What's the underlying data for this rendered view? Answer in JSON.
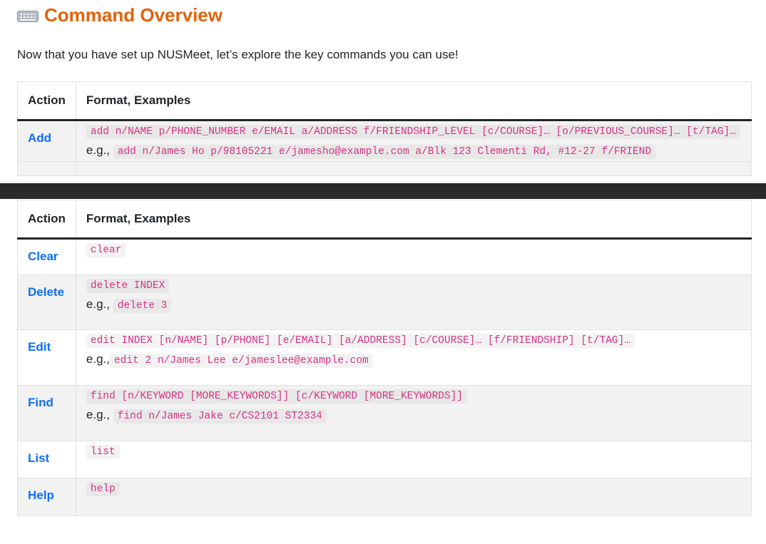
{
  "section": {
    "title": "Command Overview",
    "title_icon": "keyboard-icon",
    "intro": "Now that you have set up NUSMeet, let’s explore the key commands you can use!"
  },
  "table": {
    "headers": {
      "action": "Action",
      "format": "Format, Examples"
    },
    "eg_label": "e.g.,",
    "top_rows": [
      {
        "action": "Add",
        "format": "add n/NAME p/PHONE_NUMBER e/EMAIL a/ADDRESS f/FRIENDSHIP_LEVEL [c/COURSE]… [o/PREVIOUS_COURSE]… [t/TAG]…",
        "example": "add n/James Ho p/98105221 e/jamesho@example.com a/Blk 123 Clementi Rd, #12-27 f/FRIEND"
      }
    ],
    "rows": [
      {
        "action": "Clear",
        "format": "clear",
        "example": ""
      },
      {
        "action": "Delete",
        "format": "delete INDEX",
        "example": "delete 3"
      },
      {
        "action": "Edit",
        "format": "edit INDEX [n/NAME] [p/PHONE] [e/EMAIL] [a/ADDRESS] [c/COURSE]… [f/FRIENDSHIP] [t/TAG]…",
        "example": "edit 2 n/James Lee e/jameslee@example.com"
      },
      {
        "action": "Find",
        "format": "find [n/KEYWORD [MORE_KEYWORDS]] [c/KEYWORD [MORE_KEYWORDS]]",
        "example": "find n/James Jake c/CS2101 ST2334"
      },
      {
        "action": "List",
        "format": "list",
        "example": ""
      },
      {
        "action": "Help",
        "format": "help",
        "example": ""
      }
    ]
  },
  "colors": {
    "title": "#e36209",
    "link": "#0d6efd",
    "code": "#d63384",
    "divider": "#2b2b2b"
  }
}
